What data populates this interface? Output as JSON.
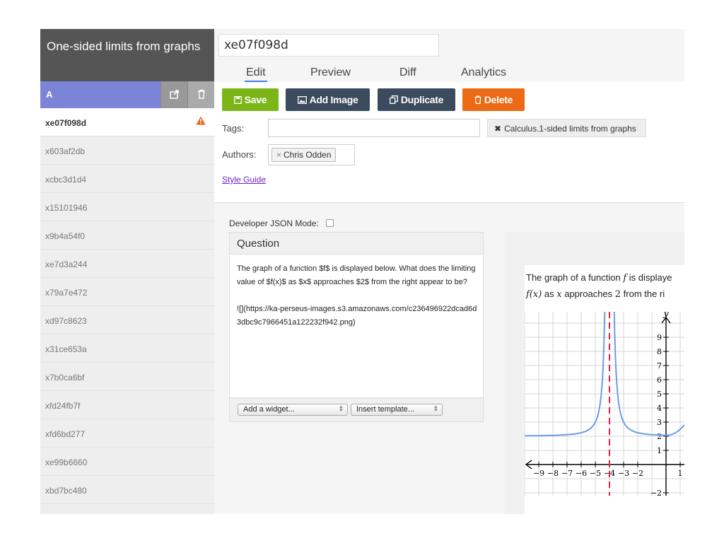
{
  "sidebar": {
    "title": "One-sided limits from graphs",
    "group_label": "A",
    "items": [
      {
        "label": "xe07f098d",
        "active": true,
        "warning": true
      },
      {
        "label": "x603af2db"
      },
      {
        "label": "xcbc3d1d4"
      },
      {
        "label": "x15101946"
      },
      {
        "label": "x9b4a54f0"
      },
      {
        "label": "xe7d3a244"
      },
      {
        "label": "x79a7e472"
      },
      {
        "label": "xd97c8623"
      },
      {
        "label": "x31ce653a"
      },
      {
        "label": "x7b0ca6bf"
      },
      {
        "label": "xfd24fb7f"
      },
      {
        "label": "xfd6bd277"
      },
      {
        "label": "xe99b6660"
      },
      {
        "label": "xbd7bc480"
      }
    ]
  },
  "header": {
    "title_value": "xe07f098d",
    "tabs": [
      "Edit",
      "Preview",
      "Diff",
      "Analytics"
    ]
  },
  "toolbar": {
    "save": "Save",
    "add_image": "Add Image",
    "duplicate": "Duplicate",
    "delete": "Delete"
  },
  "meta": {
    "tags_label": "Tags:",
    "tag_chip": "Calculus.1-sided limits from graphs",
    "authors_label": "Authors:",
    "author_chip": "Chris Odden",
    "style_guide": "Style Guide"
  },
  "editor": {
    "dev_json_label": "Developer JSON Mode:",
    "question_header": "Question",
    "body_line1": "The graph of a function $f$ is displayed below. What does the limiting value of $f(x)$ as $x$ approaches $2$ from the right appear to be?",
    "body_line2": "![](https://ka-perseus-images.s3.amazonaws.com/c236496922dcad6d3dbc9c7966451a122232f942.png)",
    "add_widget": "Add a widget...",
    "insert_template": "Insert template..."
  },
  "preview": {
    "line1_a": "The graph of a function ",
    "line1_f": "f",
    "line1_b": " is displaye",
    "line2_fx": "f(x)",
    "line2_a": " as ",
    "line2_x": "x",
    "line2_b": " approaches ",
    "line2_two": "2",
    "line2_c": " from the ri",
    "y_label": "y",
    "y_ticks": [
      "9",
      "8",
      "7",
      "6",
      "5",
      "4",
      "3",
      "2",
      "1",
      "−2"
    ],
    "x_ticks": [
      "−9",
      "−8",
      "−7",
      "−6",
      "−5",
      "−4",
      "−3",
      "−2",
      "1"
    ]
  },
  "colors": {
    "save": "#7cb518",
    "dark_button": "#3b4a5c",
    "delete": "#ec6a15",
    "group_bar": "#7c84d8",
    "curve": "#6a9ee8",
    "asymptote": "#dd2244"
  }
}
